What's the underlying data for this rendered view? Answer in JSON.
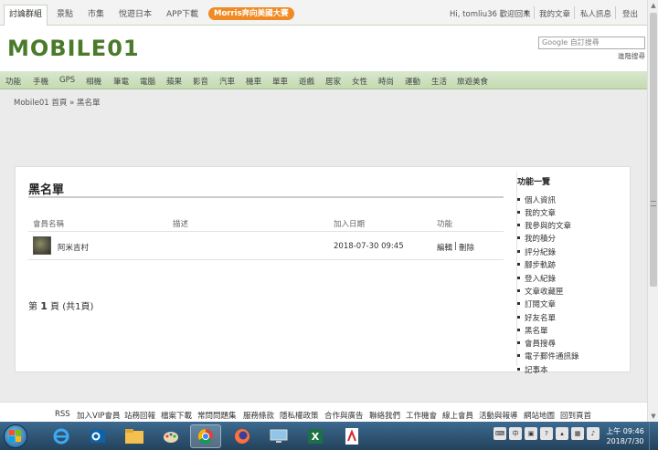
{
  "topbar": {
    "tabs": [
      "討論群組",
      "景點",
      "市集",
      "悅遊日本",
      "APP下載"
    ],
    "promo": "Morris奔向美國大賽",
    "greeting": "Hi, tomliu36 歡迎回來",
    "links": [
      "我的文章",
      "私人訊息",
      "登出"
    ]
  },
  "header": {
    "logo": "MOBILE01",
    "search_placeholder": "Google 自訂搜尋",
    "advanced_search": "進階搜尋"
  },
  "nav": {
    "items": [
      "功能",
      "手機",
      "GPS",
      "相機",
      "筆電",
      "電腦",
      "蘋果",
      "影音",
      "汽車",
      "機車",
      "單車",
      "遊戲",
      "居家",
      "女性",
      "時尚",
      "運動",
      "生活",
      "旅遊美食"
    ]
  },
  "breadcrumb": "Mobile01 首頁 » 黑名單",
  "main": {
    "title": "黑名單",
    "columns": [
      "會員名稱",
      "描述",
      "加入日期",
      "功能"
    ],
    "rows": [
      {
        "name": "阿米吉村",
        "description": "",
        "date": "2018-07-30 09:45",
        "edit": "編輯",
        "sep": "|",
        "delete": "刪除"
      }
    ],
    "pager_prefix": "第",
    "pager_page": "1",
    "pager_suffix": "頁 (共1頁)"
  },
  "sidebar": {
    "heading": "功能一覽",
    "links": [
      "個人資訊",
      "我的文章",
      "我參與的文章",
      "我的積分",
      "評分紀錄",
      "腳步軌跡",
      "登入紀錄",
      "文章收藏匣",
      "訂閱文章",
      "好友名單",
      "黑名單",
      "會員搜尋",
      "電子郵件通訊錄",
      "記事本"
    ]
  },
  "footer": {
    "links": [
      "RSS",
      "加入VIP會員",
      "站務回報",
      "檔案下載",
      "常問問題集",
      "服務條款",
      "隱私權政策",
      "合作與廣告",
      "聯絡我們",
      "工作機會",
      "線上會員",
      "活動與報導",
      "網站地圖",
      "回到頁首"
    ]
  },
  "taskbar": {
    "apps": [
      "internet-explorer",
      "outlook",
      "file-explorer",
      "paint",
      "chrome",
      "firefox",
      "remote-desktop",
      "excel",
      "acrobat"
    ],
    "time": "上午 09:46",
    "date": "2018/7/30"
  }
}
